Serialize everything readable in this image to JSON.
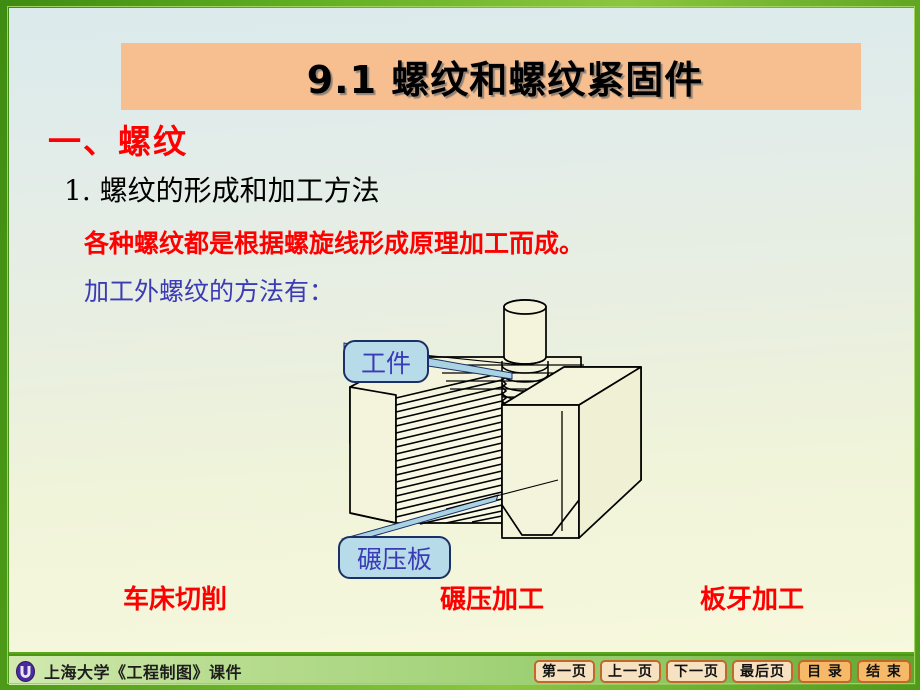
{
  "slide": {
    "title": "9.1  螺纹和螺纹紧固件",
    "heading": "一、螺纹",
    "subheading": "1. 螺纹的形成和加工方法",
    "red_note": "各种螺纹都是根据螺旋线形成原理加工而成。",
    "blue_note": "加工外螺纹的方法有：",
    "colors": {
      "title_banner": "#f7bf8f",
      "heading_red": "#ff0000",
      "note_blue": "#3b3bb5",
      "callout_fill": "#b7dbe8",
      "callout_border": "#1c2f66",
      "frame_green": "#5aa61c",
      "footer_button": "#f6e2c0",
      "footer_button_accent": "#f5b968"
    }
  },
  "diagram": {
    "callouts": [
      {
        "id": "workpiece",
        "label": "工件"
      },
      {
        "id": "plate",
        "label": "碾压板"
      }
    ],
    "captions": [
      "车床切削",
      "碾压加工",
      "板牙加工"
    ]
  },
  "footer": {
    "brand": "上海大学《工程制图》课件",
    "logo_icon": "university-emblem-icon",
    "buttons": [
      {
        "label": "第一页",
        "accent": false
      },
      {
        "label": "上一页",
        "accent": false
      },
      {
        "label": "下一页",
        "accent": false
      },
      {
        "label": "最后页",
        "accent": false
      },
      {
        "label": "目 录",
        "accent": true
      },
      {
        "label": "结 束",
        "accent": true
      }
    ]
  }
}
